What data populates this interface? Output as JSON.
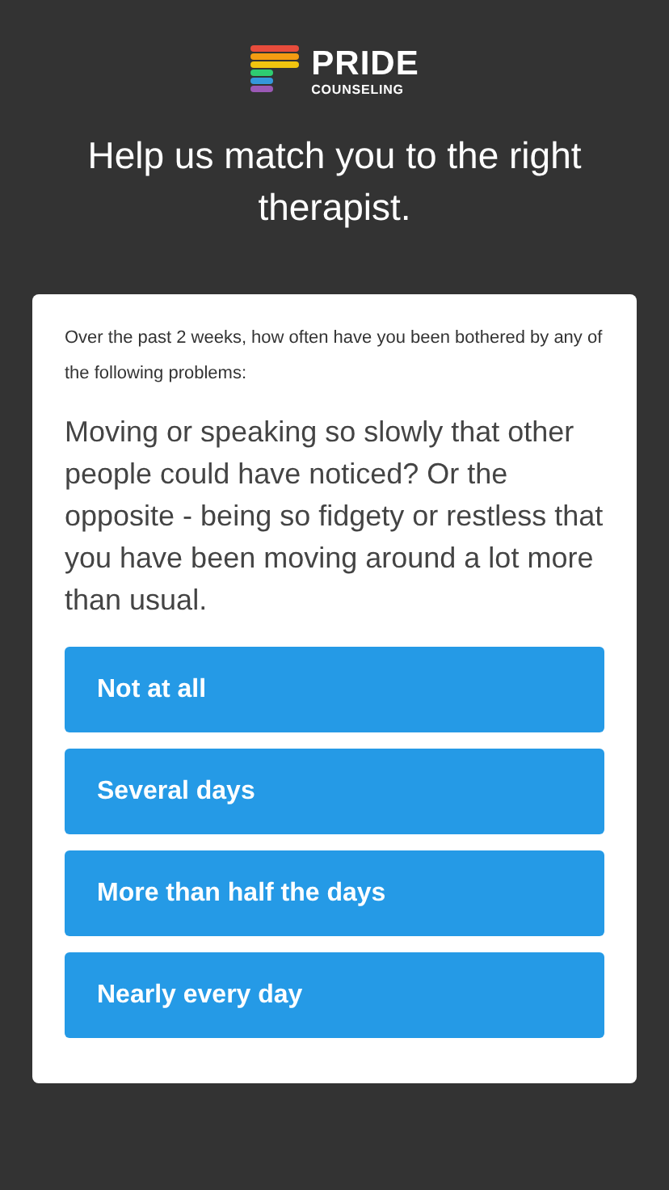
{
  "logo": {
    "title": "PRIDE",
    "subtitle": "COUNSELING"
  },
  "heading": "Help us match you to the right therapist.",
  "card": {
    "intro": "Over the past 2 weeks, how often have you been bothered by any of the following problems:",
    "question": "Moving or speaking so slowly that other people could have noticed? Or the opposite - being so fidgety or restless that you have been moving around a lot more than usual.",
    "answers": [
      "Not at all",
      "Several days",
      "More than half the days",
      "Nearly every day"
    ]
  }
}
